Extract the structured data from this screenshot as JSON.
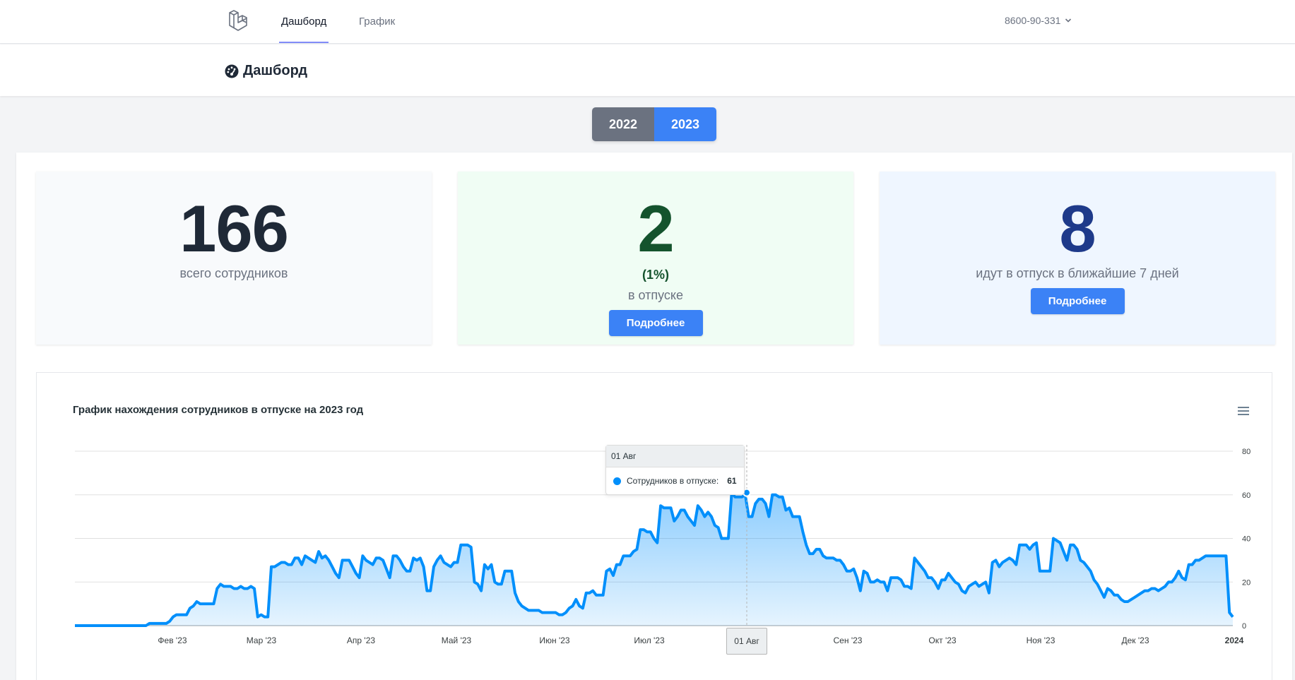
{
  "nav": {
    "links": [
      {
        "label": "Дашборд",
        "active": true
      },
      {
        "label": "График",
        "active": false
      }
    ],
    "user": "8600-90-331"
  },
  "header": {
    "title": "Дашборд"
  },
  "years": [
    {
      "label": "2022",
      "active": false
    },
    {
      "label": "2023",
      "active": true
    }
  ],
  "cards": {
    "total": {
      "value": "166",
      "label": "всего сотрудников",
      "color": "#1f2937",
      "bg": "#f8fafc"
    },
    "on_vacation": {
      "value": "2",
      "percent": "(1%)",
      "label": "в отпуске",
      "button": "Подробнее",
      "color": "#14532d",
      "bg": "#f0fdf4"
    },
    "upcoming": {
      "value": "8",
      "label": "идут в отпуск в ближайшие 7 дней",
      "button": "Подробнее",
      "color": "#1e3a8a",
      "bg": "#eff6ff"
    }
  },
  "colors": {
    "series": "#008ffb",
    "accent": "#3b82f6"
  },
  "chart_data": {
    "type": "area",
    "title": "График нахождения сотрудников в отпуске на 2023 год",
    "ylim": [
      0,
      80
    ],
    "yticks": [
      "0",
      "20",
      "40",
      "60",
      "80"
    ],
    "y_axis_side": "right",
    "xticks": [
      "Фев '23",
      "Мар '23",
      "Апр '23",
      "Май '23",
      "Июн '23",
      "Июл '23",
      "01 Авг",
      "Сен '23",
      "Окт '23",
      "Ноя '23",
      "Дек '23",
      "2024"
    ],
    "grid": true,
    "series": [
      {
        "name": "Сотрудников в отпуске",
        "values": [
          0,
          0,
          0,
          0,
          0,
          0,
          0,
          0,
          0,
          0,
          0,
          0,
          0,
          0,
          0,
          0,
          0,
          0,
          0,
          0,
          0,
          0,
          1,
          1,
          1,
          1,
          1,
          1,
          2,
          4,
          5,
          5,
          5,
          5,
          8,
          9,
          11,
          10,
          10,
          10,
          10,
          10,
          17,
          19,
          18,
          18,
          18,
          17,
          17,
          18,
          17,
          17,
          18,
          17,
          4,
          5,
          4,
          4,
          27,
          27,
          28,
          29,
          29,
          28,
          28,
          31,
          31,
          28,
          32,
          31,
          30,
          29,
          34,
          31,
          32,
          30,
          27,
          24,
          22,
          30,
          30,
          30,
          27,
          24,
          22,
          32,
          30,
          29,
          28,
          31,
          31,
          30,
          26,
          22,
          32,
          32,
          30,
          27,
          25,
          25,
          31,
          30,
          31,
          27,
          16,
          16,
          27,
          30,
          32,
          29,
          28,
          27,
          29,
          29,
          37,
          37,
          37,
          36,
          20,
          19,
          16,
          28,
          26,
          28,
          20,
          19,
          19,
          25,
          25,
          25,
          15,
          11,
          9,
          8,
          7,
          7,
          7,
          7,
          6,
          6,
          6,
          6,
          6,
          5,
          5,
          6,
          8,
          9,
          12,
          9,
          8,
          15,
          15,
          16,
          14,
          14,
          14,
          25,
          26,
          23,
          28,
          28,
          32,
          32,
          32,
          34,
          35,
          44,
          44,
          43,
          43,
          40,
          38,
          55,
          54,
          54,
          54,
          48,
          50,
          53,
          53,
          50,
          48,
          46,
          55,
          53,
          50,
          52,
          50,
          46,
          45,
          40,
          40,
          40,
          61,
          59,
          59,
          59,
          60,
          50,
          50,
          56,
          58,
          58,
          56,
          50,
          60,
          60,
          59,
          59,
          53,
          54,
          50,
          50,
          50,
          43,
          37,
          33,
          33,
          35,
          35,
          32,
          31,
          31,
          31,
          30,
          30,
          28,
          25,
          25,
          26,
          22,
          16,
          25,
          24,
          20,
          20,
          21,
          20,
          20,
          16,
          22,
          22,
          22,
          21,
          18,
          18,
          17,
          31,
          29,
          27,
          25,
          22,
          22,
          20,
          17,
          21,
          21,
          24,
          22,
          20,
          19,
          16,
          15,
          18,
          19,
          20,
          18,
          19,
          20,
          15,
          29,
          30,
          27,
          29,
          30,
          31,
          30,
          28,
          37,
          37,
          37,
          35,
          37,
          38,
          25,
          25,
          25,
          25,
          40,
          39,
          38,
          34,
          30,
          37,
          37,
          35,
          30,
          29,
          27,
          25,
          21,
          19,
          16,
          13,
          17,
          16,
          14,
          14,
          12,
          11,
          11,
          12,
          13,
          14,
          15,
          16,
          16,
          17,
          17,
          16,
          17,
          18,
          20,
          20,
          22,
          25,
          22,
          21,
          28,
          28,
          30,
          30,
          31,
          32,
          32,
          32,
          32,
          32,
          32,
          32,
          6,
          4
        ]
      }
    ],
    "highlight": {
      "x_label": "01 Авг",
      "value": 61
    }
  }
}
